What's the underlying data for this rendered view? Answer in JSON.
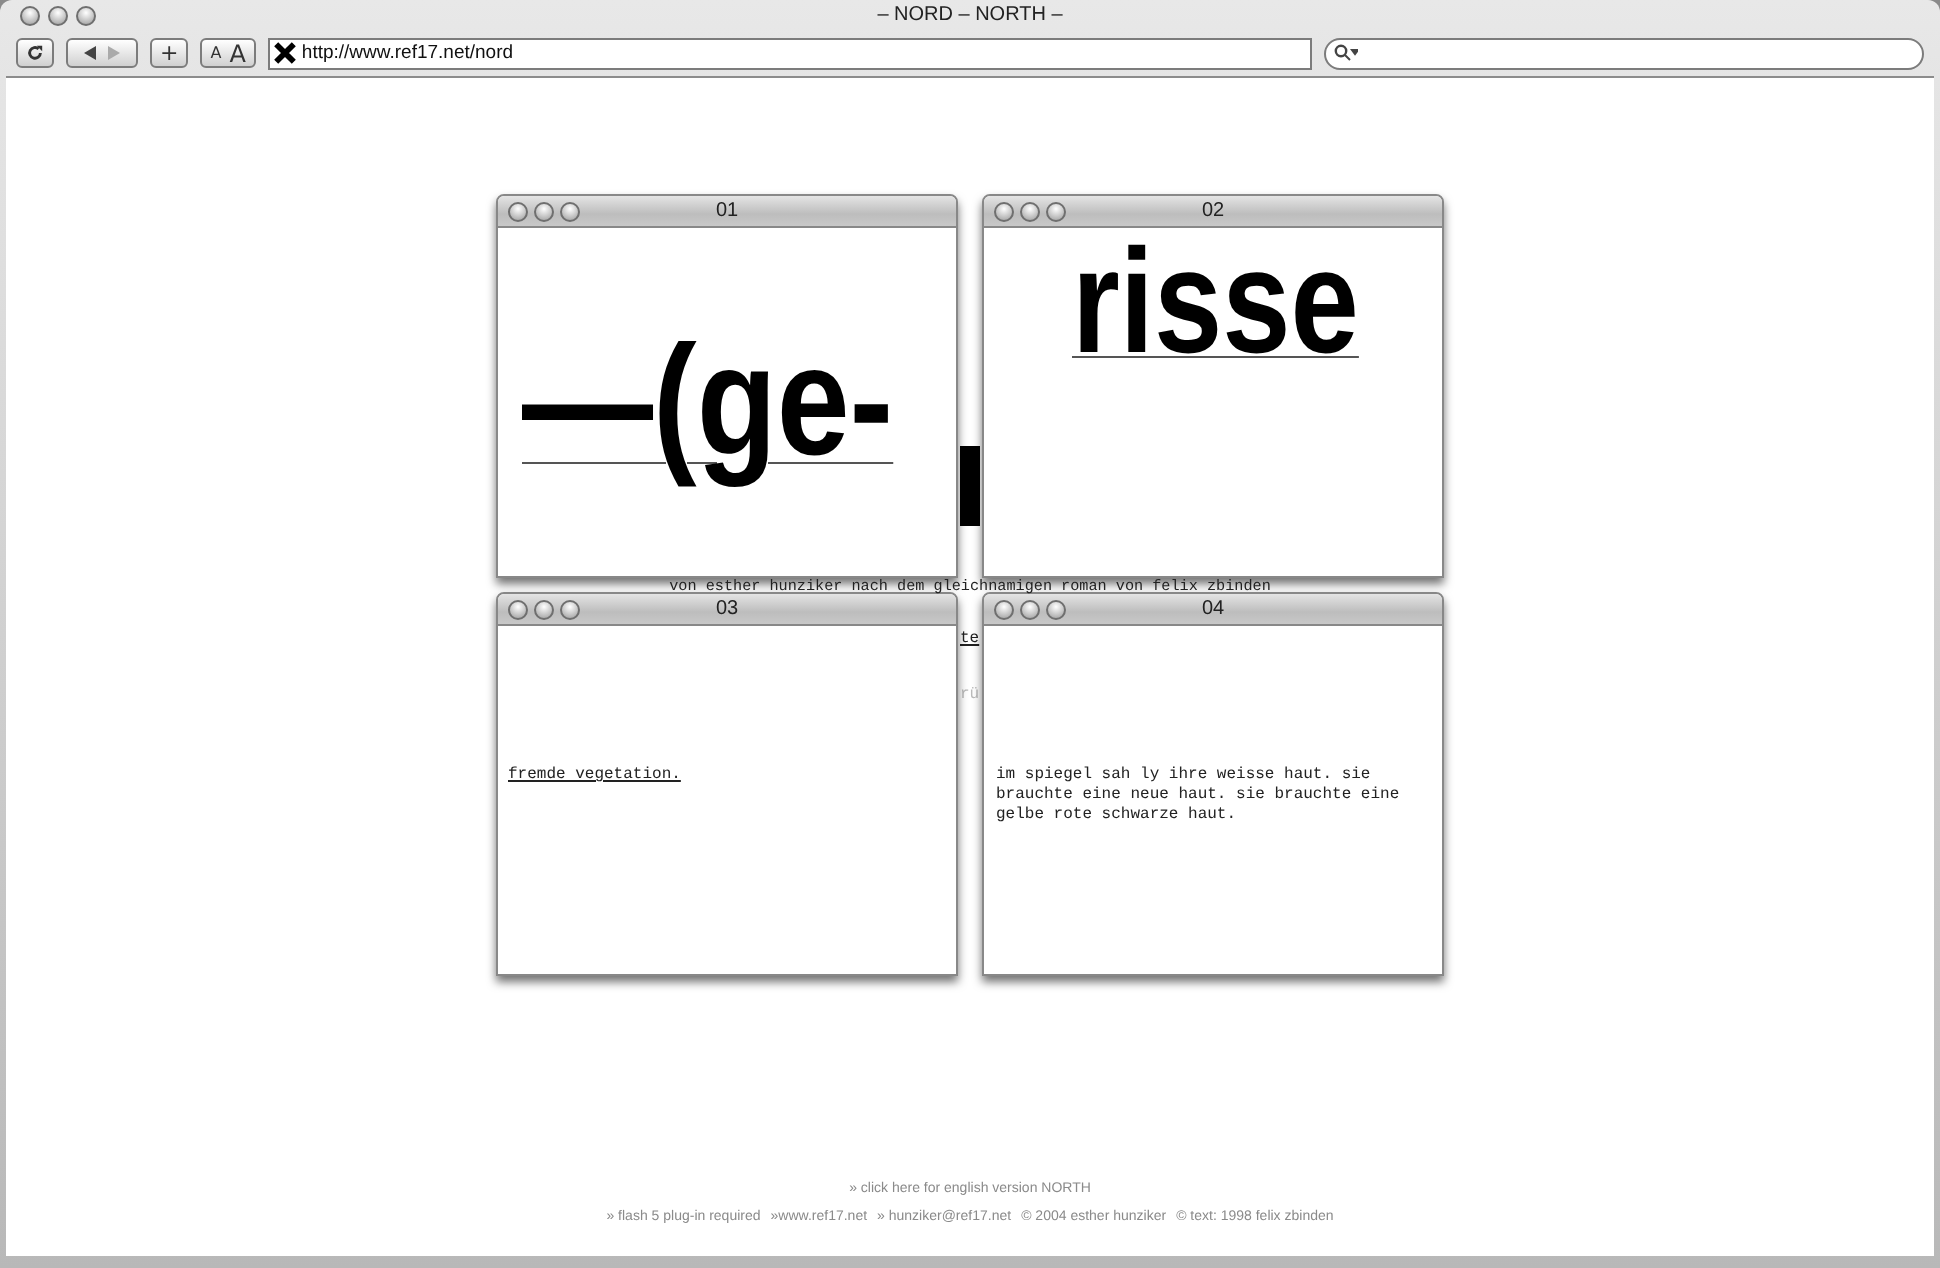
{
  "window": {
    "title": "– NORD – NORTH –"
  },
  "toolbar": {
    "add_button": "+",
    "text_size_buttons": [
      "A",
      "A"
    ],
    "address": "http://www.ref17.net/nord"
  },
  "page": {
    "subtitle": "von esther hunziker nach dem gleichnamigen roman von felix zbinden",
    "fragments": [
      {
        "text": "te",
        "kind": "link"
      },
      {
        "text": "rü",
        "kind": "faint"
      }
    ],
    "windows": [
      {
        "title": "01",
        "kind": "headline",
        "text": "—(ge-"
      },
      {
        "title": "02",
        "kind": "headline_top",
        "text": "risse"
      },
      {
        "title": "03",
        "kind": "link",
        "text": "fremde vegetation."
      },
      {
        "title": "04",
        "kind": "paragraph",
        "text": "im spiegel sah ly ihre weisse haut. sie brauchte eine neue haut. sie brauchte eine gelbe rote schwarze haut."
      }
    ],
    "footer": {
      "english_link": "» click here for english version NORTH",
      "notes": [
        "» flash 5 plug-in required",
        "»www.ref17.net",
        "» hunziker@ref17.net",
        "© 2004 esther hunziker",
        "© text: 1998 felix zbinden"
      ]
    }
  }
}
